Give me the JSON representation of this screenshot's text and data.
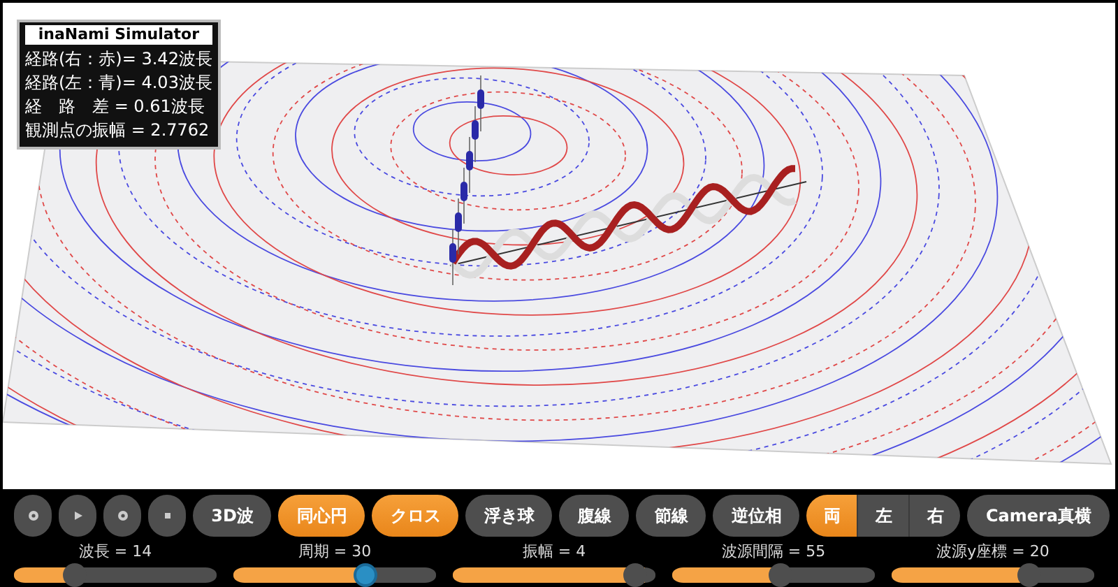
{
  "info_panel": {
    "title": "inaNami Simulator",
    "lines": [
      "経路(右：赤)= 3.42波長",
      "経路(左：青)= 4.03波長",
      "経　路　差 = 0.61波長",
      "観測点の振幅 = 2.7762"
    ]
  },
  "toggles": [
    {
      "label": "3D波",
      "selected": false
    },
    {
      "label": "同心円",
      "selected": true
    },
    {
      "label": "クロス",
      "selected": true
    },
    {
      "label": "浮き球",
      "selected": false
    },
    {
      "label": "腹線",
      "selected": false
    },
    {
      "label": "節線",
      "selected": false
    },
    {
      "label": "逆位相",
      "selected": false
    }
  ],
  "side_selector": [
    {
      "label": "両",
      "selected": true
    },
    {
      "label": "左",
      "selected": false
    },
    {
      "label": "右",
      "selected": false
    }
  ],
  "camera_button": {
    "label": "Camera真横"
  },
  "sliders": [
    {
      "label": "波長 = 14",
      "level": 0.27,
      "focused": false
    },
    {
      "label": "周期 = 30",
      "level": 0.67,
      "focused": true
    },
    {
      "label": "振幅 = 4",
      "level": 0.95,
      "focused": false
    },
    {
      "label": "波源間隔 = 55",
      "level": 0.54,
      "focused": false
    },
    {
      "label": "波源y座標 = 20",
      "level": 0.7,
      "focused": false
    }
  ]
}
